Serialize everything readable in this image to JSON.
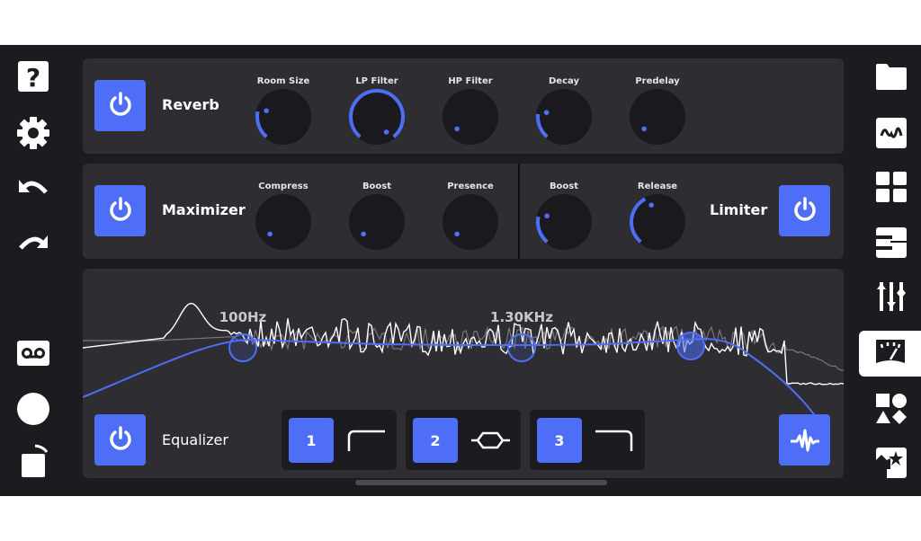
{
  "colors": {
    "accent": "#4f6ef7",
    "background": "#1c1c20",
    "panel": "#2d2d32",
    "knob": "#1a1a1e"
  },
  "left_sidebar": [
    {
      "icon": "help-icon"
    },
    {
      "icon": "gear-icon"
    },
    {
      "icon": "undo-icon"
    },
    {
      "icon": "redo-icon"
    },
    {
      "icon": "voicemail-icon"
    },
    {
      "icon": "record-icon"
    },
    {
      "icon": "rotate-square-icon"
    }
  ],
  "right_sidebar": [
    {
      "icon": "folder-icon"
    },
    {
      "icon": "waveform-icon"
    },
    {
      "icon": "grid-icon"
    },
    {
      "icon": "piano-icon"
    },
    {
      "icon": "mixer-sliders-icon"
    },
    {
      "icon": "meter-icon",
      "active": true
    },
    {
      "icon": "shapes-icon"
    },
    {
      "icon": "image-star-icon"
    }
  ],
  "reverb": {
    "title": "Reverb",
    "enabled": true,
    "knobs": [
      {
        "label": "Room Size",
        "value": 0.22
      },
      {
        "label": "LP Filter",
        "value": 1.0
      },
      {
        "label": "HP Filter",
        "value": 0.0
      },
      {
        "label": "Decay",
        "value": 0.2
      },
      {
        "label": "Predelay",
        "value": 0.0
      }
    ]
  },
  "maximizer": {
    "title": "Maximizer",
    "enabled": true,
    "knobs": [
      {
        "label": "Compress",
        "value": 0.0
      },
      {
        "label": "Boost",
        "value": 0.0
      },
      {
        "label": "Presence",
        "value": 0.0
      }
    ]
  },
  "limiter": {
    "title": "Limiter",
    "enabled": true,
    "knobs": [
      {
        "label": "Boost",
        "value": 0.22
      },
      {
        "label": "Release",
        "value": 0.4
      }
    ]
  },
  "equalizer": {
    "title": "Equalizer",
    "enabled": true,
    "band_labels": [
      "100Hz",
      "1.30KHz"
    ],
    "bands": [
      {
        "number": "1",
        "shape": "high-pass"
      },
      {
        "number": "2",
        "shape": "peak"
      },
      {
        "number": "3",
        "shape": "low-pass"
      }
    ],
    "spectrum_button_icon": "spectrum-icon"
  }
}
